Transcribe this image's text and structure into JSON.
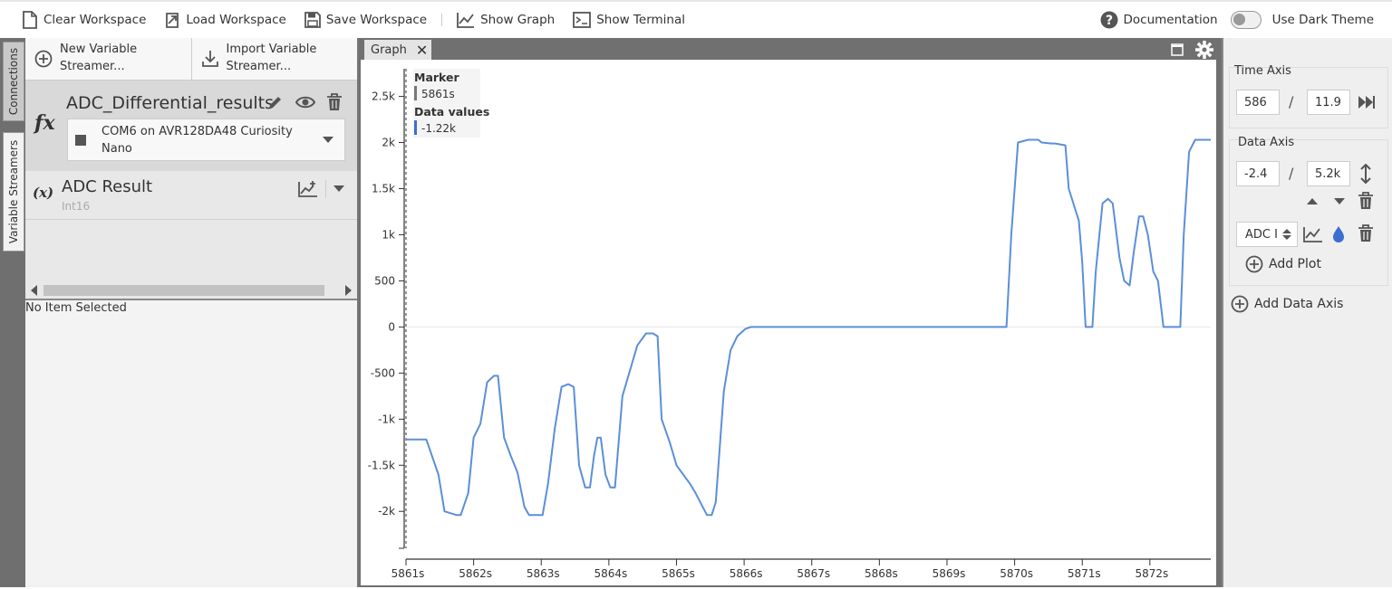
{
  "toolbar": {
    "clear": "Clear Workspace",
    "load": "Load Workspace",
    "save": "Save Workspace",
    "show_graph": "Show Graph",
    "show_terminal": "Show Terminal",
    "documentation": "Documentation",
    "dark_theme": "Use Dark Theme",
    "dark_theme_on": false
  },
  "side_tabs": {
    "connections": "Connections",
    "variable_streamers": "Variable Streamers"
  },
  "left_panel": {
    "new_streamer_line1": "New Variable",
    "new_streamer_line2": "Streamer...",
    "import_streamer_line1": "Import Variable",
    "import_streamer_line2": "Streamer...",
    "streamer": {
      "icon": "fx",
      "name": "ADC_Differential_results",
      "port_line1": "COM6 on AVR128DA48 Curiosity",
      "port_line2": "Nano"
    },
    "variable": {
      "icon": "(x)",
      "name": "ADC Result",
      "type": "Int16"
    },
    "status": "No Item Selected"
  },
  "graph": {
    "tab_label": "Graph",
    "marker_title": "Marker",
    "marker_value": "5861s",
    "data_values_title": "Data values",
    "data_value": "-1.22k",
    "series_color": "#5b8fd9"
  },
  "chart_data": {
    "type": "line",
    "title": "",
    "xlabel": "",
    "ylabel": "",
    "xlim": [
      5861,
      5872.9
    ],
    "ylim": [
      -2400,
      2800
    ],
    "x_ticks": [
      "5861s",
      "5862s",
      "5863s",
      "5864s",
      "5865s",
      "5866s",
      "5867s",
      "5868s",
      "5869s",
      "5870s",
      "5871s",
      "5872s"
    ],
    "y_ticks": [
      "2.5k",
      "2k",
      "1.5k",
      "1k",
      "500",
      "0",
      "-500",
      "-1k",
      "-1.5k",
      "-2k"
    ],
    "series": [
      {
        "x": [
          5861.0,
          5861.3,
          5861.48,
          5861.57,
          5861.75,
          5861.81,
          5861.92,
          5862.0,
          5862.1,
          5862.2,
          5862.3,
          5862.36,
          5862.45,
          5862.55,
          5862.65,
          5862.75,
          5862.82,
          5863.02,
          5863.1,
          5863.2,
          5863.3,
          5863.4,
          5863.48,
          5863.56,
          5863.65,
          5863.72,
          5863.78,
          5863.83,
          5863.88,
          5863.95,
          5864.02,
          5864.09,
          5864.2,
          5864.3,
          5864.42,
          5864.55,
          5864.65,
          5864.72,
          5864.78,
          5864.9,
          5865.0,
          5865.1,
          5865.2,
          5865.28,
          5865.45,
          5865.52,
          5865.58,
          5865.7,
          5865.8,
          5865.9,
          5866.02,
          5866.1,
          5866.3,
          5867.0,
          5868.0,
          5869.0,
          5869.8,
          5869.88,
          5869.95,
          5870.05,
          5870.2,
          5870.35,
          5870.4,
          5870.55,
          5870.6,
          5870.75,
          5870.8,
          5870.95,
          5871.0,
          5871.05,
          5871.15,
          5871.2,
          5871.3,
          5871.38,
          5871.45,
          5871.55,
          5871.62,
          5871.7,
          5871.76,
          5871.84,
          5871.9,
          5871.97,
          5872.05,
          5872.12,
          5872.2,
          5872.25,
          5872.3,
          5872.38,
          5872.45,
          5872.5,
          5872.58,
          5872.67,
          5872.9
        ],
        "y": [
          -1220,
          -1220,
          -1600,
          -2000,
          -2040,
          -2040,
          -1800,
          -1200,
          -1050,
          -600,
          -530,
          -530,
          -1200,
          -1400,
          -1580,
          -1950,
          -2040,
          -2040,
          -1700,
          -1100,
          -650,
          -620,
          -650,
          -1500,
          -1740,
          -1740,
          -1400,
          -1200,
          -1200,
          -1600,
          -1740,
          -1740,
          -750,
          -500,
          -200,
          -70,
          -70,
          -100,
          -1000,
          -1250,
          -1500,
          -1600,
          -1700,
          -1800,
          -2040,
          -2040,
          -1900,
          -700,
          -250,
          -100,
          -20,
          0,
          0,
          0,
          0,
          0,
          0,
          0,
          1000,
          2000,
          2030,
          2030,
          2000,
          1990,
          1990,
          1970,
          1500,
          1150,
          700,
          0,
          0,
          600,
          1340,
          1390,
          1340,
          750,
          500,
          450,
          800,
          1200,
          1200,
          1000,
          600,
          500,
          0,
          0,
          0,
          0,
          0,
          1000,
          1900,
          2030,
          2030
        ]
      }
    ]
  },
  "right_panel": {
    "time_axis_title": "Time Axis",
    "time_start": "586",
    "time_span": "11.9",
    "data_axis_title": "Data Axis",
    "data_min": "-2.4",
    "data_max": "5.2k",
    "plot_select": "ADC I",
    "add_plot": "Add Plot",
    "add_data_axis": "Add Data Axis"
  }
}
